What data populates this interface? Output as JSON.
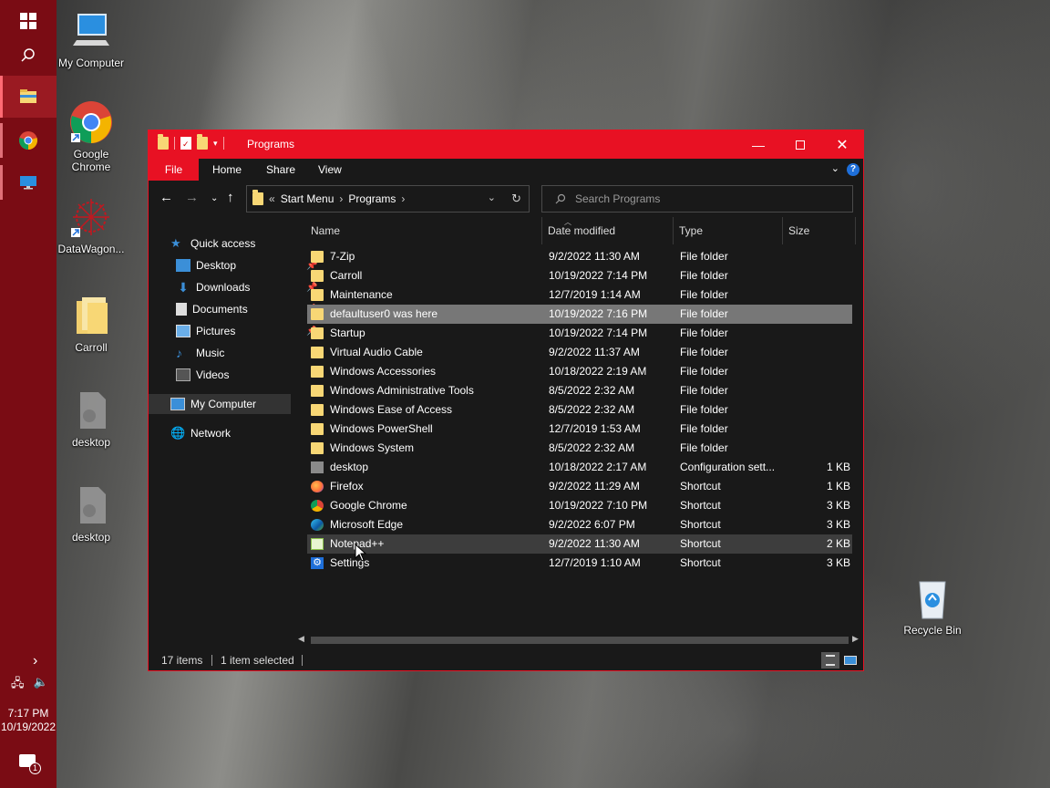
{
  "taskbar": {
    "clock_time": "7:17 PM",
    "clock_date": "10/19/2022",
    "notification_count": "1"
  },
  "desktop": {
    "icons": [
      {
        "label": "My Computer",
        "icon": "monitor-icon"
      },
      {
        "label": "Google Chrome",
        "icon": "chrome-icon"
      },
      {
        "label": "DataWagon...",
        "icon": "datawagon-icon"
      },
      {
        "label": "Carroll",
        "icon": "folder-icon"
      },
      {
        "label": "desktop",
        "icon": "settings-file-icon"
      },
      {
        "label": "desktop",
        "icon": "settings-file-icon"
      },
      {
        "label": "Recycle Bin",
        "icon": "recycle-bin-icon"
      }
    ]
  },
  "window": {
    "title": "Programs",
    "accent": "#e81123",
    "ribbon_tabs": [
      "File",
      "Home",
      "Share",
      "View"
    ],
    "address": {
      "prefix": "«",
      "crumbs": [
        "Start Menu",
        "Programs"
      ]
    },
    "search_placeholder": "Search Programs",
    "columns": [
      "Name",
      "Date modified",
      "Type",
      "Size"
    ],
    "nav": {
      "quick_access": "Quick access",
      "items": [
        {
          "label": "Desktop",
          "icon": "desktop-icon"
        },
        {
          "label": "Downloads",
          "icon": "download-icon"
        },
        {
          "label": "Documents",
          "icon": "document-icon"
        },
        {
          "label": "Pictures",
          "icon": "pictures-icon"
        },
        {
          "label": "Music",
          "icon": "music-icon"
        },
        {
          "label": "Videos",
          "icon": "video-icon"
        }
      ],
      "my_computer": "My Computer",
      "network": "Network"
    },
    "files": [
      {
        "name": "7-Zip",
        "date": "9/2/2022 11:30 AM",
        "type": "File folder",
        "size": ""
      },
      {
        "name": "Carroll",
        "date": "10/19/2022 7:14 PM",
        "type": "File folder",
        "size": ""
      },
      {
        "name": "Maintenance",
        "date": "12/7/2019 1:14 AM",
        "type": "File folder",
        "size": ""
      },
      {
        "name": "defaultuser0 was here",
        "date": "10/19/2022 7:16 PM",
        "type": "File folder",
        "size": ""
      },
      {
        "name": "Startup",
        "date": "10/19/2022 7:14 PM",
        "type": "File folder",
        "size": ""
      },
      {
        "name": "Virtual Audio Cable",
        "date": "9/2/2022 11:37 AM",
        "type": "File folder",
        "size": ""
      },
      {
        "name": "Windows Accessories",
        "date": "10/18/2022 2:19 AM",
        "type": "File folder",
        "size": ""
      },
      {
        "name": "Windows Administrative Tools",
        "date": "8/5/2022 2:32 AM",
        "type": "File folder",
        "size": ""
      },
      {
        "name": "Windows Ease of Access",
        "date": "8/5/2022 2:32 AM",
        "type": "File folder",
        "size": ""
      },
      {
        "name": "Windows PowerShell",
        "date": "12/7/2019 1:53 AM",
        "type": "File folder",
        "size": ""
      },
      {
        "name": "Windows System",
        "date": "8/5/2022 2:32 AM",
        "type": "File folder",
        "size": ""
      },
      {
        "name": "desktop",
        "date": "10/18/2022 2:17 AM",
        "type": "Configuration sett...",
        "size": "1 KB"
      },
      {
        "name": "Firefox",
        "date": "9/2/2022 11:29 AM",
        "type": "Shortcut",
        "size": "1 KB"
      },
      {
        "name": "Google Chrome",
        "date": "10/19/2022 7:10 PM",
        "type": "Shortcut",
        "size": "3 KB"
      },
      {
        "name": "Microsoft Edge",
        "date": "9/2/2022 6:07 PM",
        "type": "Shortcut",
        "size": "3 KB"
      },
      {
        "name": "Notepad++",
        "date": "9/2/2022 11:30 AM",
        "type": "Shortcut",
        "size": "2 KB"
      },
      {
        "name": "Settings",
        "date": "12/7/2019 1:10 AM",
        "type": "Shortcut",
        "size": "3 KB"
      }
    ],
    "status": {
      "count": "17 items",
      "selection": "1 item selected"
    }
  }
}
